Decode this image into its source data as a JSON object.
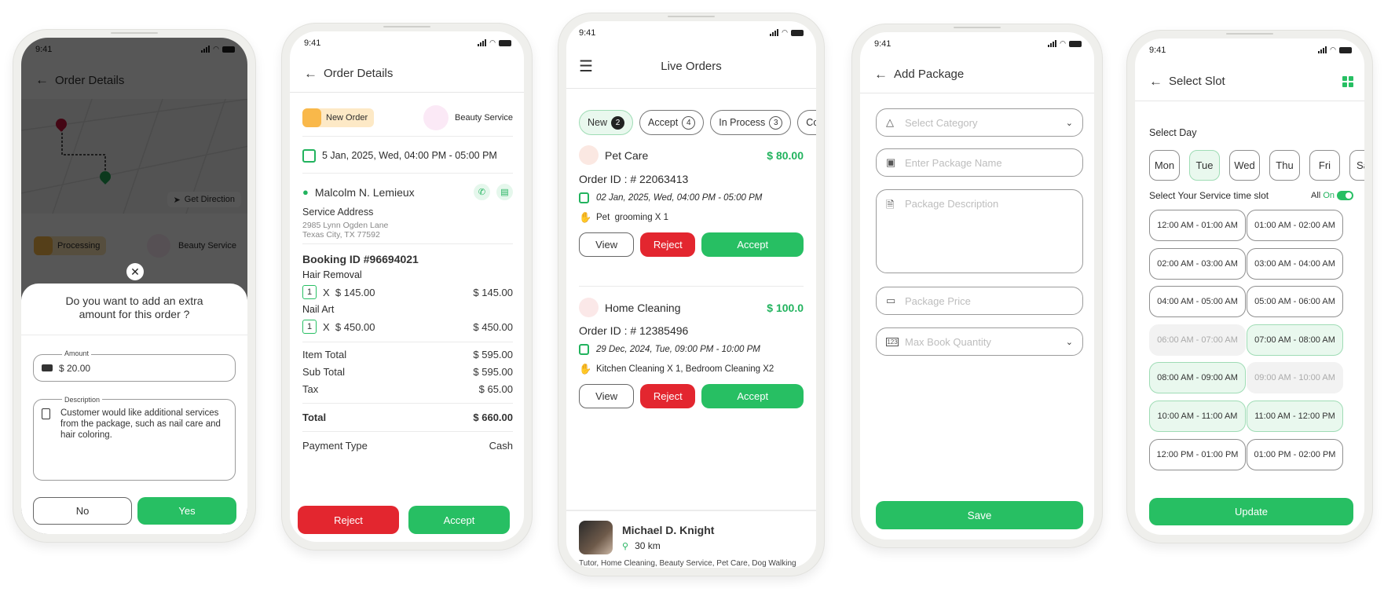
{
  "status_time": "9:41",
  "colors": {
    "accent": "#27bf63",
    "danger": "#e3262f",
    "pending": "#f9b84a"
  },
  "phone1": {
    "title": "Order Details",
    "get_direction": "Get Direction",
    "status_label": "Processing",
    "service_label": "Beauty Service",
    "dialog": {
      "question": "Do you want to add an extra amount for this order ?",
      "amount_label": "Amount",
      "amount_value": "$ 20.00",
      "description_label": "Description",
      "description_value": "Customer would like additional services from the package, such as nail care and hair coloring.",
      "no_label": "No",
      "yes_label": "Yes"
    }
  },
  "phone2": {
    "title": "Order Details",
    "status_label": "New Order",
    "service_label": "Beauty Service",
    "datetime": "5 Jan, 2025, Wed, 04:00 PM - 05:00 PM",
    "customer_name": "Malcolm N. Lemieux",
    "address_label": "Service Address",
    "address_line1": "2985 Lynn Ogden Lane",
    "address_line2": "Texas City, TX 77592",
    "booking_id": "Booking ID #96694021",
    "items": [
      {
        "name": "Hair Removal",
        "qty": "1",
        "unit": "X  $ 145.00",
        "total": "$ 145.00"
      },
      {
        "name": "Nail Art",
        "qty": "1",
        "unit": "X  $ 450.00",
        "total": "$ 450.00"
      }
    ],
    "summary": [
      {
        "label": "Item Total",
        "value": "$ 595.00"
      },
      {
        "label": "Sub Total",
        "value": "$ 595.00"
      },
      {
        "label": "Tax",
        "value": "$ 65.00"
      }
    ],
    "total_label": "Total",
    "total_value": "$ 660.00",
    "payment_label": "Payment Type",
    "payment_value": "Cash",
    "reject_label": "Reject",
    "accept_label": "Accept"
  },
  "phone3": {
    "title": "Live Orders",
    "tabs": [
      {
        "label": "New",
        "count": "2"
      },
      {
        "label": "Accept",
        "count": "4"
      },
      {
        "label": "In Process",
        "count": "3"
      },
      {
        "label": "Comp",
        "count": ""
      }
    ],
    "orders": [
      {
        "service": "Pet Care",
        "price": "$ 80.00",
        "order_id": "Order ID : # 22063413",
        "datetime": "02 Jan, 2025, Wed, 04:00 PM - 05:00 PM",
        "items": "Pet  grooming X 1"
      },
      {
        "service": "Home Cleaning",
        "price": "$ 100.0",
        "order_id": "Order ID : # 12385496",
        "datetime": "29 Dec, 2024, Tue, 09:00 PM - 10:00 PM",
        "items": "Kitchen Cleaning X 1, Bedroom Cleaning X2"
      }
    ],
    "view_label": "View",
    "reject_label": "Reject",
    "accept_label": "Accept",
    "provider": {
      "name": "Michael D. Knight",
      "distance": "30 km",
      "services": "Tutor, Home Cleaning, Beauty Service, Pet Care, Dog Walking"
    }
  },
  "phone4": {
    "title": "Add Package",
    "category_placeholder": "Select Category",
    "name_placeholder": "Enter Package Name",
    "description_placeholder": "Package Description",
    "price_placeholder": "Package Price",
    "quantity_placeholder": "Max Book Quantity",
    "save_label": "Save"
  },
  "phone5": {
    "title": "Select Slot",
    "select_day_label": "Select Day",
    "days": [
      "Mon",
      "Tue",
      "Wed",
      "Thu",
      "Fri",
      "Sa"
    ],
    "selected_day": "Tue",
    "slot_label": "Select Your Service time slot",
    "all_label": "All",
    "toggle_label": "On",
    "slots": [
      {
        "label": "12:00 AM - 01:00 AM",
        "state": "normal"
      },
      {
        "label": "01:00 AM - 02:00 AM",
        "state": "normal"
      },
      {
        "label": "02:00 AM - 03:00 AM",
        "state": "normal"
      },
      {
        "label": "03:00 AM - 04:00 AM",
        "state": "normal"
      },
      {
        "label": "04:00 AM - 05:00 AM",
        "state": "normal"
      },
      {
        "label": "05:00 AM - 06:00 AM",
        "state": "normal"
      },
      {
        "label": "06:00 AM - 07:00 AM",
        "state": "disabled"
      },
      {
        "label": "07:00 AM - 08:00 AM",
        "state": "selected"
      },
      {
        "label": "08:00 AM - 09:00 AM",
        "state": "selected"
      },
      {
        "label": "09:00 AM - 10:00 AM",
        "state": "disabled"
      },
      {
        "label": "10:00 AM - 11:00 AM",
        "state": "selected"
      },
      {
        "label": "11:00 AM - 12:00 PM",
        "state": "selected"
      },
      {
        "label": "12:00 PM - 01:00 PM",
        "state": "normal"
      },
      {
        "label": "01:00 PM - 02:00 PM",
        "state": "normal"
      }
    ],
    "update_label": "Update"
  }
}
